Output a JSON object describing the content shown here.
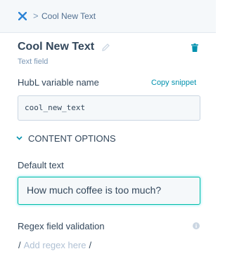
{
  "breadcrumb": {
    "icon": "hubspot-sprocket-icon",
    "separator": ">",
    "label": "Cool New Text"
  },
  "field": {
    "title": "Cool New Text",
    "type": "Text field",
    "edit_icon": "pencil-icon",
    "delete_icon": "trash-icon"
  },
  "hubl": {
    "label": "HubL variable name",
    "copy_label": "Copy snippet",
    "value": "cool_new_text"
  },
  "content_options": {
    "title": "CONTENT OPTIONS",
    "expanded_icon": "chevron-down-icon"
  },
  "default_text": {
    "label": "Default text",
    "value": "How much coffee is too much?"
  },
  "regex": {
    "label": "Regex field validation",
    "info_icon": "info-icon",
    "open_slash": "/",
    "placeholder": "Add regex here",
    "close_slash": "/"
  },
  "colors": {
    "accent_teal": "#00bda5",
    "link": "#0091ae",
    "text": "#33475b",
    "muted": "#7c98b6",
    "brand_blue": "#2c84d6"
  }
}
